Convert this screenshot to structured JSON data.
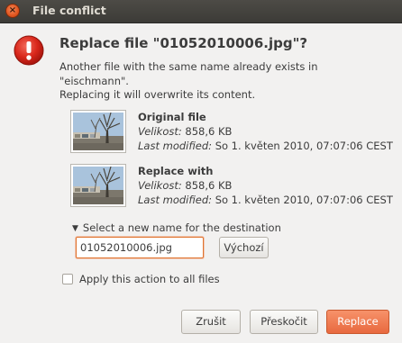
{
  "window": {
    "title": "File conflict",
    "close_glyph": "×"
  },
  "dialog": {
    "heading": "Replace file \"01052010006.jpg\"?",
    "message_lines": [
      "Another file with the same name already exists in",
      "\"eischmann\".",
      "Replacing it will overwrite its content."
    ],
    "icon": "dialog-error-icon",
    "accent_color": "#e0551f"
  },
  "original": {
    "title": "Original file",
    "size_label": "Velikost:",
    "size_value": "858,6 KB",
    "modified_label": "Last modified:",
    "modified_value": "So 1. květen 2010, 07:07:06 CEST"
  },
  "replacement": {
    "title": "Replace with",
    "size_label": "Velikost:",
    "size_value": "858,6 KB",
    "modified_label": "Last modified:",
    "modified_value": "So 1. květen 2010, 07:07:06 CEST"
  },
  "rename": {
    "expander_arrow": "▼",
    "expander_label": "Select a new name for the destination",
    "input_value": "01052010006.jpg",
    "reset_label": "Výchozí"
  },
  "apply_all": {
    "label": "Apply this action to all files",
    "checked": false
  },
  "buttons": {
    "cancel": "Zrušit",
    "skip": "Přeskočit",
    "replace": "Replace"
  }
}
